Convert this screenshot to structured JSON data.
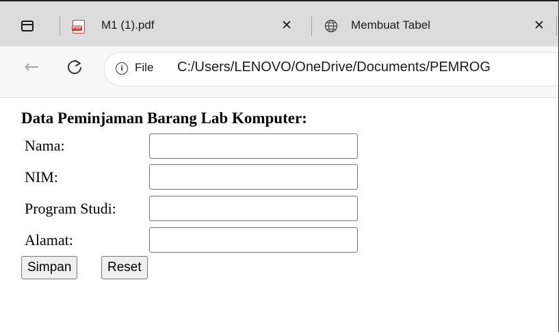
{
  "browser": {
    "tabs": [
      {
        "title": "M1 (1).pdf",
        "icon": "pdf-file-icon",
        "close_label": "✕"
      },
      {
        "title": "Membuat Tabel",
        "icon": "globe-icon",
        "close_label": "✕"
      }
    ],
    "address_bar": {
      "site_info_label": "File",
      "url": "C:/Users/LENOVO/OneDrive/Documents/PEMROG"
    }
  },
  "form": {
    "title": "Data Peminjaman Barang Lab Komputer:",
    "fields": [
      {
        "label": "Nama:",
        "value": ""
      },
      {
        "label": "NIM:",
        "value": ""
      },
      {
        "label": "Program Studi:",
        "value": ""
      },
      {
        "label": "Alamat:",
        "value": ""
      }
    ],
    "buttons": {
      "submit": "Simpan",
      "reset": "Reset"
    }
  }
}
